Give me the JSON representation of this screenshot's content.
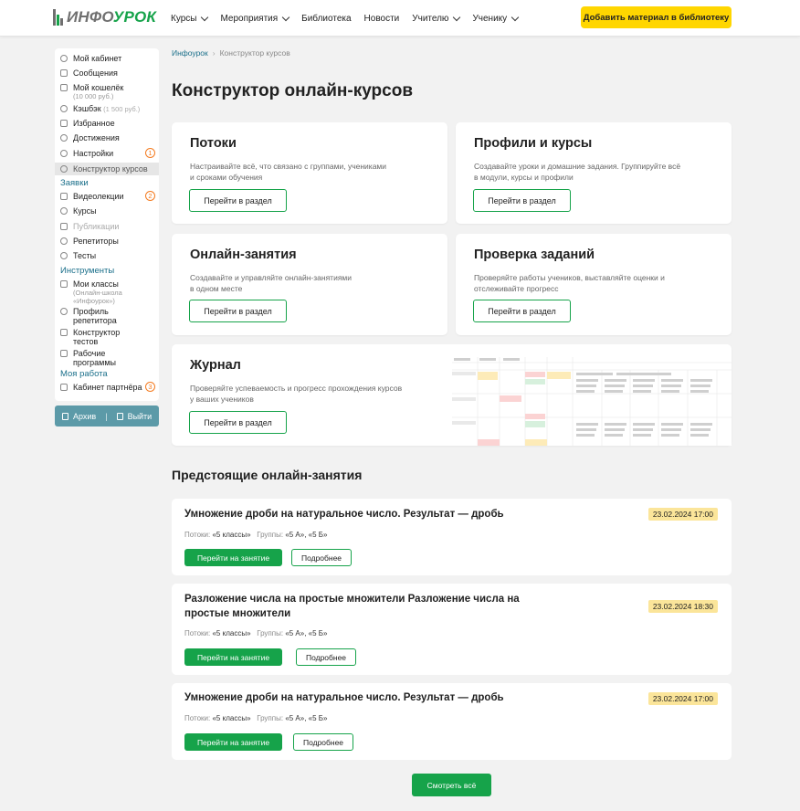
{
  "header": {
    "logo_text_left": "ИНФО",
    "logo_text_right": "УРОК",
    "nav": [
      "Курсы",
      "Мероприятия",
      "Библиотека",
      "Новости",
      "Учителю",
      "Ученику"
    ],
    "cta": "Добавить материал в библиотеку"
  },
  "sidebar": {
    "items": [
      {
        "label": "Мой кабинет"
      },
      {
        "label": "Сообщения"
      },
      {
        "label": "Мой кошелёк",
        "sub": "(10 000 руб.)"
      },
      {
        "label": "Кэшбэк",
        "sub_inline": "(1 500 руб.)"
      },
      {
        "label": "Избранное"
      },
      {
        "label": "Достижения"
      },
      {
        "label": "Настройки",
        "badge": "1"
      },
      {
        "label": "Конструктор курсов"
      }
    ],
    "section_requests": "Заявки",
    "requests": [
      {
        "label": "Видеолекции",
        "badge": "2"
      },
      {
        "label": "Курсы"
      },
      {
        "label": "Публикации"
      },
      {
        "label": "Репетиторы"
      },
      {
        "label": "Тесты"
      }
    ],
    "section_tools": "Инструменты",
    "tools": [
      {
        "label": "Мои классы",
        "sub": "(Онлайн-школа «Инфоурок»)"
      },
      {
        "label": "Профиль репетитора"
      },
      {
        "label": "Конструктор тестов"
      },
      {
        "label": "Рабочие программы"
      }
    ],
    "section_work": "Моя работа",
    "work": [
      {
        "label": "Кабинет партнёра",
        "badge": "3"
      }
    ],
    "archive": "Архив",
    "logout": "Выйти"
  },
  "breadcrumbs": [
    "Инфоурок",
    "Конструктор курсов"
  ],
  "page_title": "Конструктор онлайн-курсов",
  "sections": [
    {
      "title": "Потоки",
      "desc1": "Настраивайте всё, что связано с группами, учениками",
      "desc2": "и сроками обучения",
      "button": "Перейти в раздел"
    },
    {
      "title": "Профили и курсы",
      "desc1": "Создавайте уроки и домашние задания. Группируйте всё",
      "desc2": "в модули, курсы и профили",
      "button": "Перейти в раздел"
    },
    {
      "title": "Онлайн-занятия",
      "desc1": "Создавайте и управляйте онлайн-занятиями",
      "desc2": "в одном месте",
      "button": "Перейти в раздел"
    },
    {
      "title": "Проверка заданий",
      "desc1": "Проверяйте работы учеников, выставляйте оценки и",
      "desc2": "отслеживайте прогресс",
      "button": "Перейти в раздел"
    },
    {
      "title": "Журнал",
      "desc1": "Проверяйте успеваемость и прогресс прохождения курсов",
      "desc2": "у ваших учеников",
      "button": "Перейти в раздел"
    }
  ],
  "upcoming_title": "Предстоящие онлайн-занятия",
  "lessons": [
    {
      "title": "Умножение дроби на натуральное число. Результат — дробь",
      "date": "23.02.2024  17:00",
      "streams_label": "Потоки:",
      "streams": "«5 классы»",
      "groups_label": "Группы:",
      "groups": "«5 А», «5 Б»",
      "go": "Перейти на занятие",
      "more": "Подробнее"
    },
    {
      "title": "Разложение числа на простые множители Разложение числа на простые множители",
      "date": "23.02.2024  18:30",
      "streams_label": "Потоки:",
      "streams": "«5 классы»",
      "groups_label": "Группы:",
      "groups": "«5 А», «5 Б»",
      "go": "Перейти на занятие",
      "more": "Подробнее"
    },
    {
      "title": "Умножение дроби на натуральное число. Результат — дробь",
      "date": "23.02.2024  17:00",
      "streams_label": "Потоки:",
      "streams": "«5 классы»",
      "groups_label": "Группы:",
      "groups": "«5 А», «5 Б»",
      "go": "Перейти на занятие",
      "more": "Подробнее"
    }
  ],
  "show_all": "Смотреть всё",
  "colors": {
    "accent_green": "#16a34a",
    "cta_yellow": "#ffd600",
    "date_badge": "#fbe59a",
    "link_blue": "#1a6f8a",
    "badge_orange": "#f47b20"
  }
}
